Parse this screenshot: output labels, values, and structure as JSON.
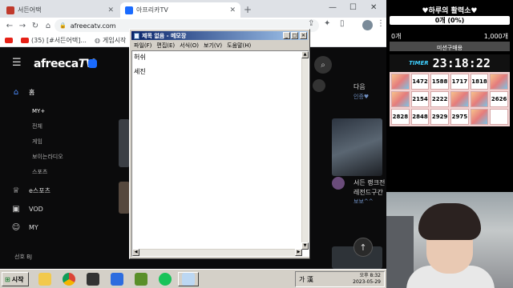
{
  "browser": {
    "tabs": [
      {
        "label": "서든어택",
        "active": false
      },
      {
        "label": "아프리카TV",
        "active": true
      }
    ],
    "new_tab": "+",
    "url": "afreecatv.com",
    "bookmarks": [
      {
        "label": "(35) [#서든어택]...",
        "icon": "youtube"
      },
      {
        "label": "게임시작",
        "icon": "globe"
      }
    ],
    "window_controls": {
      "minimize": "—",
      "maximize": "☐",
      "close": "✕"
    }
  },
  "afreeca": {
    "logo": "afreeca",
    "logo_tv": "TV",
    "nav": {
      "home": "홈",
      "my_plus": "MY+",
      "sub_items": [
        "전체",
        "게임",
        "보이는라디오",
        "스포츠"
      ],
      "esports": "e스포츠",
      "vod": "VOD",
      "my": "MY",
      "recommended_bj": "선호 BJ"
    },
    "side_list": [
      {
        "title": "다음",
        "sub": "인증♥"
      },
      {
        "title": "서든 랭크전",
        "title2": "레전드구간",
        "sub": "보보^^"
      }
    ]
  },
  "notepad": {
    "title": "제목 없음 - 메모장",
    "menus": [
      "파일(F)",
      "편집(E)",
      "서식(O)",
      "보기(V)",
      "도움말(H)"
    ],
    "lines": [
      "허쉬",
      "세진"
    ]
  },
  "taskbar": {
    "start": "시작",
    "tray_ime": "가 漢",
    "time": "오후 8:32",
    "date": "2023-05-29"
  },
  "overlay": {
    "title": "♥하루의 활력소♥",
    "progress_text": "0개 (0%)",
    "progress": 0,
    "min_label": "0개",
    "max_label": "1,000개",
    "mission": "미션구매용",
    "timer_tag": "TIMER",
    "timer": "23:18:22",
    "grid": [
      [
        "img",
        "1472",
        "1588",
        "1717",
        "1818",
        "img"
      ],
      [
        "img",
        "2154",
        "2222",
        "img",
        "img",
        "2626"
      ],
      [
        "2828",
        "2848",
        "2929",
        "2975",
        "img",
        ""
      ]
    ]
  },
  "colors": {
    "accent_blue": "#1a6bff",
    "winxp_title": "#0a246a",
    "overlay_progress": "#ffd84d"
  }
}
